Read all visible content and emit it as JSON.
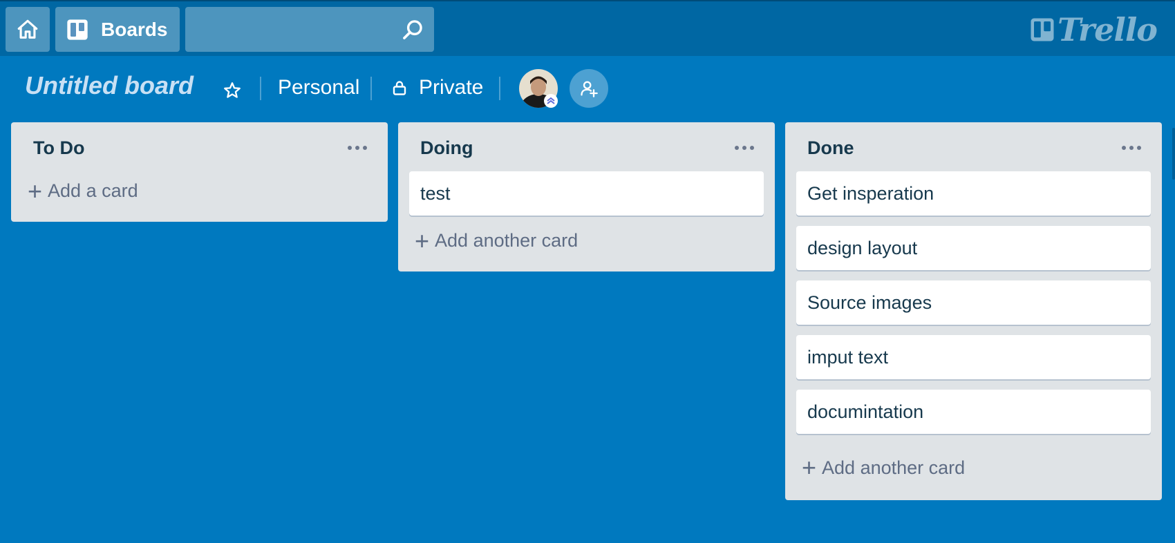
{
  "header": {
    "boards_label": "Boards",
    "search_value": "",
    "logo_text": "Trello"
  },
  "board": {
    "title": "Untitled board",
    "team_label": "Personal",
    "visibility_label": "Private"
  },
  "lists": [
    {
      "title": "To Do",
      "cards": [],
      "add_label": "Add a card"
    },
    {
      "title": "Doing",
      "cards": [
        "test"
      ],
      "add_label": "Add another card"
    },
    {
      "title": "Done",
      "cards": [
        "Get insperation",
        "design layout",
        "Source images",
        "imput text",
        "documintation"
      ],
      "add_label": "Add another card"
    }
  ],
  "icons": {
    "home": "home-icon",
    "boards": "boards-icon",
    "search": "search-icon",
    "star": "star-icon",
    "lock": "lock-icon",
    "invite": "add-member-icon",
    "menu": "more-dots-icon"
  },
  "colors": {
    "board_background": "#0079bf",
    "header_background": "#0067a3",
    "list_background": "#dfe3e6"
  }
}
